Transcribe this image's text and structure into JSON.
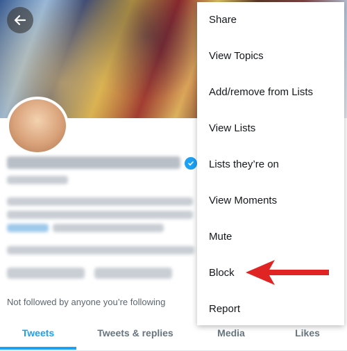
{
  "menu": {
    "items": [
      {
        "label": "Share"
      },
      {
        "label": "View Topics"
      },
      {
        "label": "Add/remove from Lists"
      },
      {
        "label": "View Lists"
      },
      {
        "label": "Lists they’re on"
      },
      {
        "label": "View Moments"
      },
      {
        "label": "Mute"
      },
      {
        "label": "Block"
      },
      {
        "label": "Report"
      }
    ]
  },
  "profile": {
    "followed_note": "Not followed by anyone you’re following"
  },
  "tabs": [
    {
      "label": "Tweets",
      "active": true
    },
    {
      "label": "Tweets & replies",
      "active": false
    },
    {
      "label": "Media",
      "active": false
    },
    {
      "label": "Likes",
      "active": false
    }
  ],
  "colors": {
    "accent": "#1da1f2",
    "annotation_arrow": "#e02424"
  },
  "icons": {
    "back": "arrow-left-icon",
    "verified": "verified-badge-icon"
  }
}
